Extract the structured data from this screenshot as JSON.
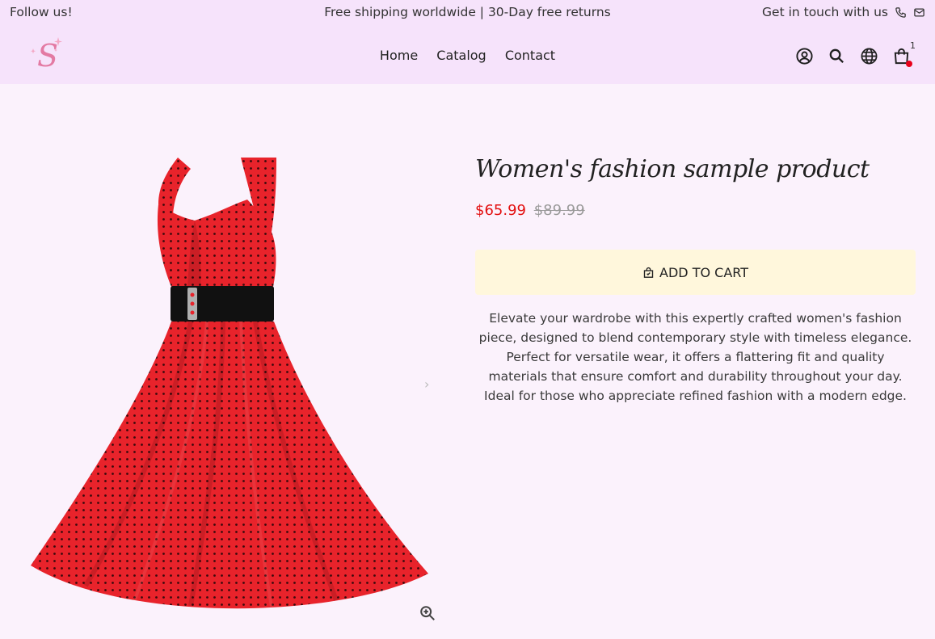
{
  "topbar": {
    "follow": "Follow us!",
    "announcement": "Free shipping worldwide | 30-Day free returns",
    "contact": "Get in touch with us",
    "icons": [
      "phone-icon",
      "mail-icon"
    ]
  },
  "header": {
    "logo_letter": "S",
    "nav": [
      "Home",
      "Catalog",
      "Contact"
    ],
    "icons": [
      "account-icon",
      "search-icon",
      "globe-icon",
      "cart-icon"
    ],
    "cart_count": "1"
  },
  "product": {
    "title": "Women's fashion sample product",
    "price_sale": "$65.99",
    "price_compare": "$89.99",
    "add_to_cart": "ADD TO CART",
    "description": "Elevate your wardrobe with this expertly crafted women's fashion piece, designed to blend contemporary style with timeless elegance. Perfect for versatile wear, it offers a flattering fit and quality materials that ensure comfort and durability throughout your day. Ideal for those who appreciate refined fashion with a modern edge.",
    "next_arrow": "›"
  },
  "colors": {
    "background": "#fbf2fc",
    "header": "#f6e3fb",
    "sale_price": "#e31010",
    "cart_button": "#fff7dc",
    "dress": "#e8232b",
    "logo": "#e37aa3"
  }
}
